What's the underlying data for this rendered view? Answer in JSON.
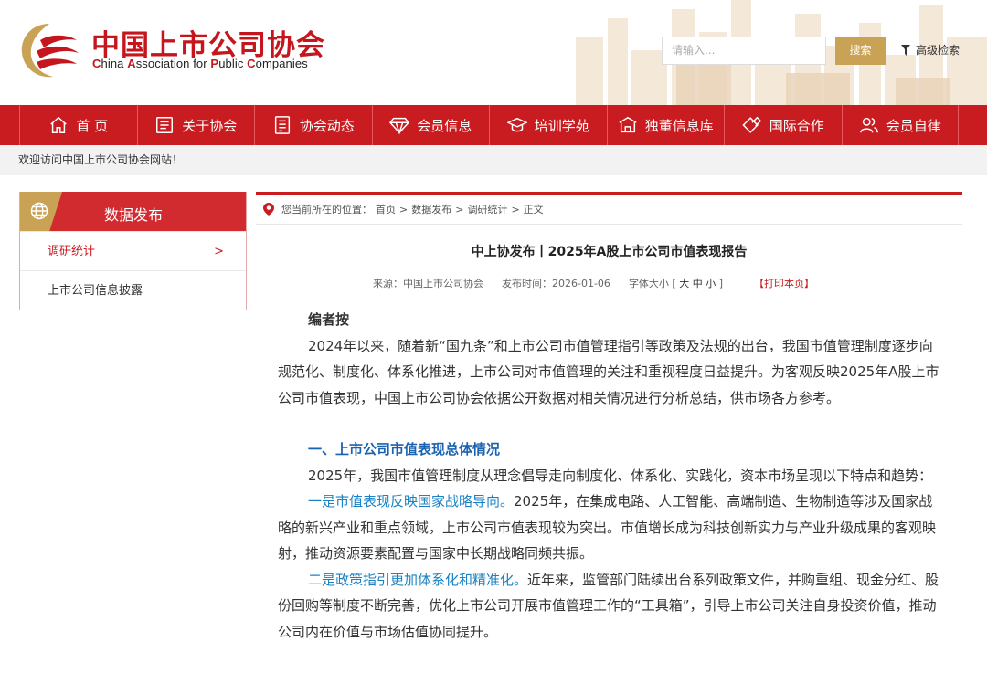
{
  "header": {
    "logo_cn": "中国上市公司协会",
    "logo_en_parts": [
      "C",
      "hina ",
      "A",
      "ssociation for ",
      "P",
      "ublic ",
      "C",
      "ompanies"
    ],
    "search_placeholder": "请输入...",
    "search_button": "搜索",
    "advanced_search": "高级检索"
  },
  "nav": {
    "items": [
      {
        "label": "首 页",
        "icon": "home-icon"
      },
      {
        "label": "关于协会",
        "icon": "document-list-icon"
      },
      {
        "label": "协会动态",
        "icon": "news-icon"
      },
      {
        "label": "会员信息",
        "icon": "diamond-icon"
      },
      {
        "label": "培训学苑",
        "icon": "graduation-cap-icon"
      },
      {
        "label": "独董信息库",
        "icon": "building-icon"
      },
      {
        "label": "国际合作",
        "icon": "handshake-icon"
      },
      {
        "label": "会员自律",
        "icon": "people-icon"
      }
    ]
  },
  "welcome": "欢迎访问中国上市公司协会网站！",
  "sidebar": {
    "title": "数据发布",
    "items": [
      {
        "label": "调研统计",
        "arrow": ">"
      },
      {
        "label": "上市公司信息披露"
      }
    ]
  },
  "breadcrumb": {
    "prefix": "您当前所在的位置：",
    "items": [
      "首页",
      "数据发布",
      "调研统计",
      "正文"
    ],
    "sep": ">"
  },
  "article": {
    "title": "中上协发布丨2025年A股上市公司市值表现报告",
    "source": "来源：中国上市公司协会",
    "date": "发布时间：2026-01-06",
    "font_size_label": "字体大小 [",
    "font_sizes": "大 中 小",
    "font_size_close": "]",
    "print": "【打印本页】",
    "editor_note": "编者按",
    "editor_text": "2024年以来，随着新“国九条”和上市公司市值管理指引等政策及法规的出台，我国市值管理制度逐步向规范化、制度化、体系化推进，上市公司对市值管理的关注和重视程度日益提升。为客观反映2025年A股上市公司市值表现，中国上市公司协会依据公开数据对相关情况进行分析总结，供市场各方参考。",
    "section1": "一、上市公司市值表现总体情况",
    "section1_intro": "2025年，我国市值管理制度从理念倡导走向制度化、体系化、实践化，资本市场呈现以下特点和趋势：",
    "point1_lead": "一是市值表现反映国家战略导向。",
    "point1_text": "2025年，在集成电路、人工智能、高端制造、生物制造等涉及国家战略的新兴产业和重点领域，上市公司市值表现较为突出。市值增长成为科技创新实力与产业升级成果的客观映射，推动资源要素配置与国家中长期战略同频共振。",
    "point2_lead": "二是政策指引更加体系化和精准化。",
    "point2_text": "近年来，监管部门陆续出台系列政策文件，并购重组、现金分红、股份回购等制度不断完善，优化上市公司开展市值管理工作的“工具箱”，引导上市公司关注自身投资价值，推动公司内在价值与市场估值协同提升。"
  },
  "colors": {
    "brand_red": "#c91c20",
    "gold": "#c9a255",
    "link_blue": "#1a82c4"
  }
}
